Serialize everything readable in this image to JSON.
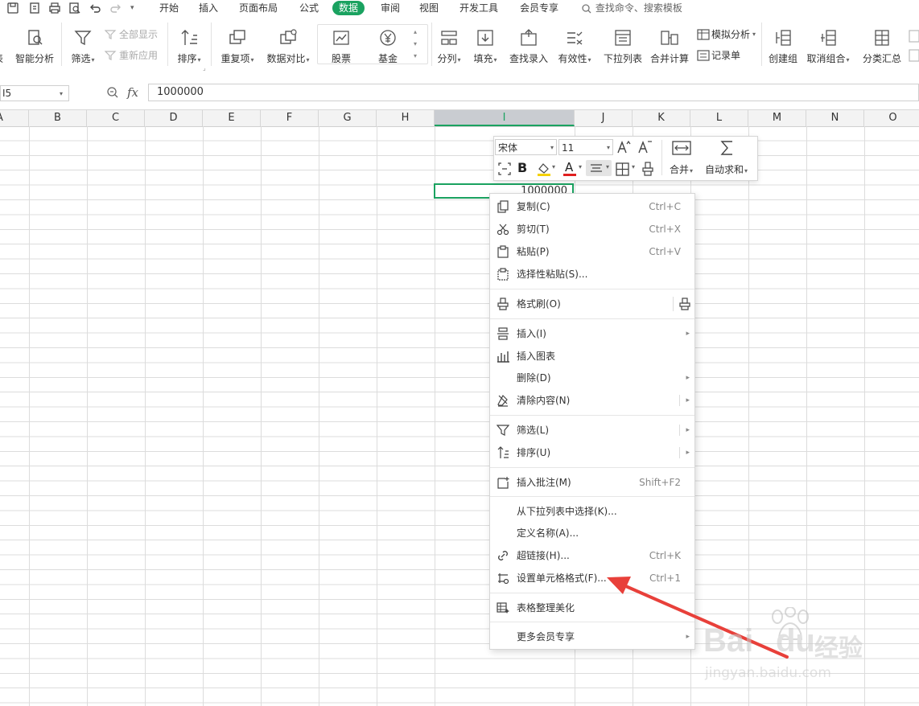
{
  "menu_tabs": [
    "开始",
    "插入",
    "页面布局",
    "公式",
    "数据",
    "审阅",
    "视图",
    "开发工具",
    "会员专享"
  ],
  "search_placeholder": "查找命令、搜索模板",
  "ribbon": {
    "smart_analysis": "智能分析",
    "filter": "筛选",
    "show_all": "全部显示",
    "reapply": "重新应用",
    "sort": "排序",
    "duplicates": "重复项",
    "compare": "数据对比",
    "stocks": "股票",
    "funds": "基金",
    "split": "分列",
    "fill": "填充",
    "lookup_entry": "查找录入",
    "validity": "有效性",
    "dropdown_list": "下拉列表",
    "consolidate": "合并计算",
    "what_if": "模拟分析",
    "record_form": "记录单",
    "group": "创建组",
    "ungroup": "取消组合",
    "subtotal": "分类汇总"
  },
  "formula_bar": {
    "name_box": "I5",
    "fx_label": "fx",
    "value": "1000000"
  },
  "columns": [
    "A",
    "B",
    "C",
    "D",
    "E",
    "F",
    "G",
    "H",
    "I",
    "J",
    "K",
    "L",
    "M",
    "N",
    "O"
  ],
  "selected_cell_value": "1000000",
  "mini_toolbar": {
    "font_name": "宋体",
    "font_size": "11",
    "bold": "B",
    "font_color": "A",
    "merge": "合并",
    "autosum": "自动求和"
  },
  "context_menu": {
    "items": [
      {
        "label": "复制(C)",
        "key": "Ctrl+C"
      },
      {
        "label": "剪切(T)",
        "key": "Ctrl+X"
      },
      {
        "label": "粘贴(P)",
        "key": "Ctrl+V"
      },
      {
        "label": "选择性粘贴(S)...",
        "key": ""
      },
      {
        "label": "格式刷(O)",
        "key": ""
      },
      {
        "label": "插入(I)",
        "key": ""
      },
      {
        "label": "插入图表",
        "key": ""
      },
      {
        "label": "删除(D)",
        "key": ""
      },
      {
        "label": "清除内容(N)",
        "key": ""
      },
      {
        "label": "筛选(L)",
        "key": ""
      },
      {
        "label": "排序(U)",
        "key": ""
      },
      {
        "label": "插入批注(M)",
        "key": "Shift+F2"
      },
      {
        "label": "从下拉列表中选择(K)...",
        "key": ""
      },
      {
        "label": "定义名称(A)...",
        "key": ""
      },
      {
        "label": "超链接(H)...",
        "key": "Ctrl+K"
      },
      {
        "label": "设置单元格格式(F)...",
        "key": "Ctrl+1"
      },
      {
        "label": "表格整理美化",
        "key": ""
      },
      {
        "label": "更多会员专享",
        "key": ""
      }
    ]
  },
  "watermark": {
    "brand": "Bai",
    "brand2": "du",
    "product": "经验",
    "url": "jingyan.baidu.com"
  },
  "colors": {
    "accent_green": "#1aa260",
    "arrow_red": "#e8403a"
  }
}
